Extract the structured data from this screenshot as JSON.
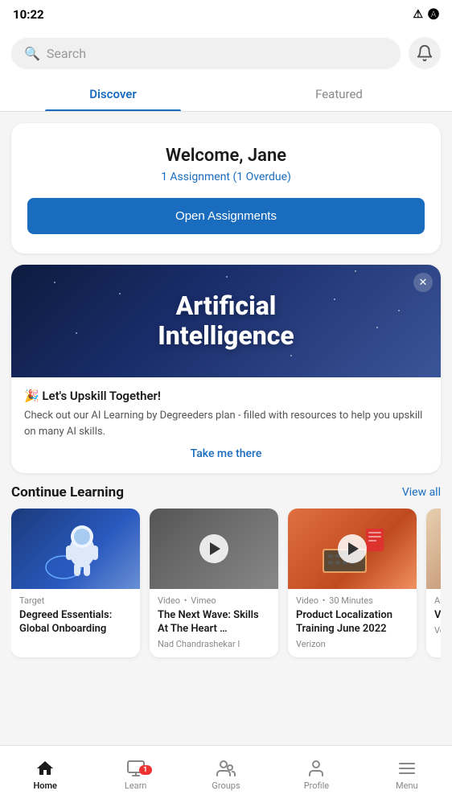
{
  "statusBar": {
    "time": "10:22",
    "icons": [
      "warning-icon",
      "alert-icon"
    ]
  },
  "search": {
    "placeholder": "Search",
    "bell_label": "Notifications"
  },
  "tabs": [
    {
      "id": "discover",
      "label": "Discover",
      "active": true
    },
    {
      "id": "featured",
      "label": "Featured",
      "active": false
    }
  ],
  "welcome": {
    "greeting": "Welcome, Jane",
    "assignment_text": "1 Assignment (1 Overdue)",
    "button_label": "Open Assignments"
  },
  "ai_banner": {
    "title_line1": "Artificial",
    "title_line2": "Intelligence",
    "headline": "🎉 Let's Upskill Together!",
    "description": "Check out our AI Learning by Degreeders plan - filled with resources to help you upskill on many AI skills.",
    "cta_label": "Take me there",
    "close_label": "✕"
  },
  "continue_learning": {
    "section_title": "Continue Learning",
    "view_all_label": "View all",
    "cards": [
      {
        "tag": "Target",
        "type": "",
        "provider": "",
        "title": "Degreed Essentials: Global Onboarding",
        "author": "",
        "has_play": false,
        "thumb_type": "astronaut"
      },
      {
        "tag": "Video",
        "type": "Vimeo",
        "provider": "",
        "title": "The Next Wave: Skills At The Heart …",
        "author": "Nad Chandrashekar I",
        "has_play": true,
        "thumb_type": "dark"
      },
      {
        "tag": "Video",
        "type": "30 Minutes",
        "provider": "",
        "title": "Product Localization Training June 2022",
        "author": "Verizon",
        "has_play": true,
        "thumb_type": "orange"
      },
      {
        "tag": "Article",
        "type": "",
        "provider": "Verizon",
        "title": "Verizon … With D…",
        "author": "Verizon Wom…",
        "has_play": false,
        "thumb_type": "person"
      }
    ]
  },
  "bottomNav": {
    "items": [
      {
        "id": "home",
        "label": "Home",
        "icon": "home",
        "active": true,
        "badge": null
      },
      {
        "id": "learn",
        "label": "Learn",
        "icon": "learn",
        "active": false,
        "badge": "1"
      },
      {
        "id": "groups",
        "label": "Groups",
        "icon": "groups",
        "active": false,
        "badge": null
      },
      {
        "id": "profile",
        "label": "Profile",
        "icon": "profile",
        "active": false,
        "badge": null
      },
      {
        "id": "menu",
        "label": "Menu",
        "icon": "menu",
        "active": false,
        "badge": null
      }
    ]
  }
}
